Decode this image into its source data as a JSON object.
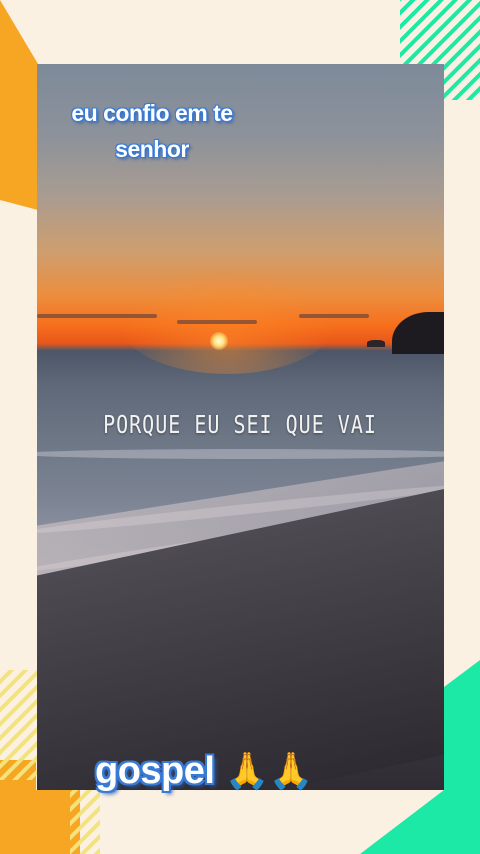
{
  "overlay": {
    "top_caption_line1": "eu confio em te",
    "top_caption_line2": "senhor",
    "lyric": "PORQUE EU SEI QUE VAI",
    "bottom_caption": "gospel",
    "bottom_emoji": "🙏🙏"
  },
  "colors": {
    "page_background": "#fbf1e3",
    "accent_orange": "#f6a623",
    "accent_green": "#1de9a6",
    "accent_yellow": "#f3e37a",
    "caption_outline": "#3a7bd5"
  }
}
